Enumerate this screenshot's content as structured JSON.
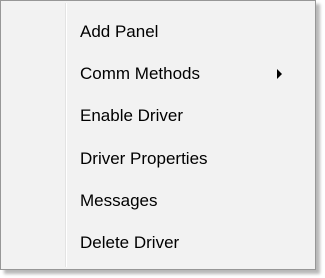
{
  "context_menu": {
    "items": [
      {
        "label": "Add Panel",
        "has_submenu": false
      },
      {
        "label": "Comm Methods",
        "has_submenu": true,
        "submenu_icon": "chevron-right-icon"
      },
      {
        "label": "Enable Driver",
        "has_submenu": false
      },
      {
        "label": "Driver Properties",
        "has_submenu": false
      },
      {
        "label": "Messages",
        "has_submenu": false
      },
      {
        "label": "Delete Driver",
        "has_submenu": false
      }
    ]
  },
  "colors": {
    "menu_background": "#f2f2f2",
    "menu_border": "#979797",
    "text": "#000000"
  }
}
